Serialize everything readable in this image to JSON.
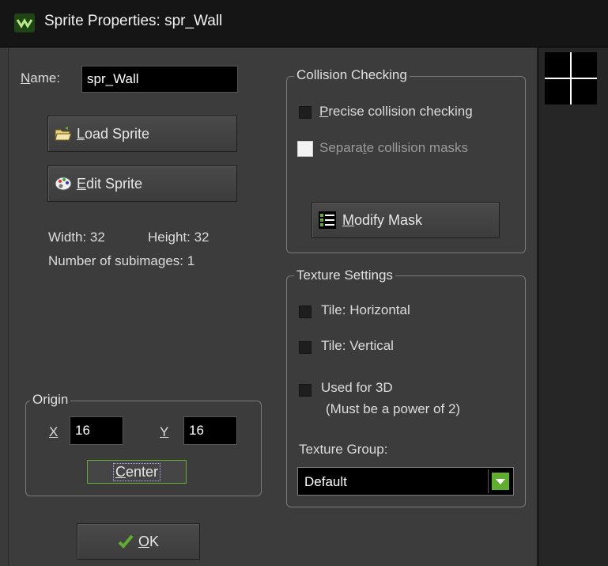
{
  "window": {
    "title": "Sprite Properties: spr_Wall",
    "icon": "gamemaker-icon"
  },
  "name_field": {
    "label": "Name:",
    "label_accel": "N",
    "label_rest": "ame:",
    "value": "spr_Wall"
  },
  "buttons": {
    "load_sprite": {
      "accel": "L",
      "rest": "oad Sprite",
      "icon": "folder-open-icon"
    },
    "edit_sprite": {
      "accel": "E",
      "rest": "dit Sprite",
      "icon": "palette-icon"
    },
    "modify_mask": {
      "accel": "M",
      "rest": "odify Mask",
      "icon": "mask-list-icon"
    },
    "center": {
      "accel": "C",
      "rest": "enter"
    },
    "ok": {
      "accel": "O",
      "rest": "K",
      "icon": "checkmark-icon"
    }
  },
  "info": {
    "width_text": "Width: 32",
    "height_text": "Height: 32",
    "subimages_text": "Number of subimages: 1"
  },
  "origin": {
    "title": "Origin",
    "x_label": "X",
    "x_value": "16",
    "y_label": "Y",
    "y_value": "16"
  },
  "collision": {
    "title": "Collision Checking",
    "precise": {
      "accel": "P",
      "rest": "recise collision checking",
      "checked": false
    },
    "separate": {
      "pre": "Separa",
      "accel": "t",
      "rest": "e collision masks",
      "checked": false,
      "enabled": false
    }
  },
  "texture": {
    "title": "Texture Settings",
    "tile_horizontal": {
      "label": "Tile: Horizontal",
      "checked": false
    },
    "tile_vertical": {
      "label": "Tile: Vertical",
      "checked": false
    },
    "used_3d": {
      "label": "Used for 3D",
      "note": "(Must be a power of 2)",
      "checked": false
    },
    "group_label": "Texture Group:",
    "group_value": "Default"
  },
  "colors": {
    "accent_green": "#5fae2e",
    "background": "#3c3c3c",
    "title_bar": "#151515"
  }
}
